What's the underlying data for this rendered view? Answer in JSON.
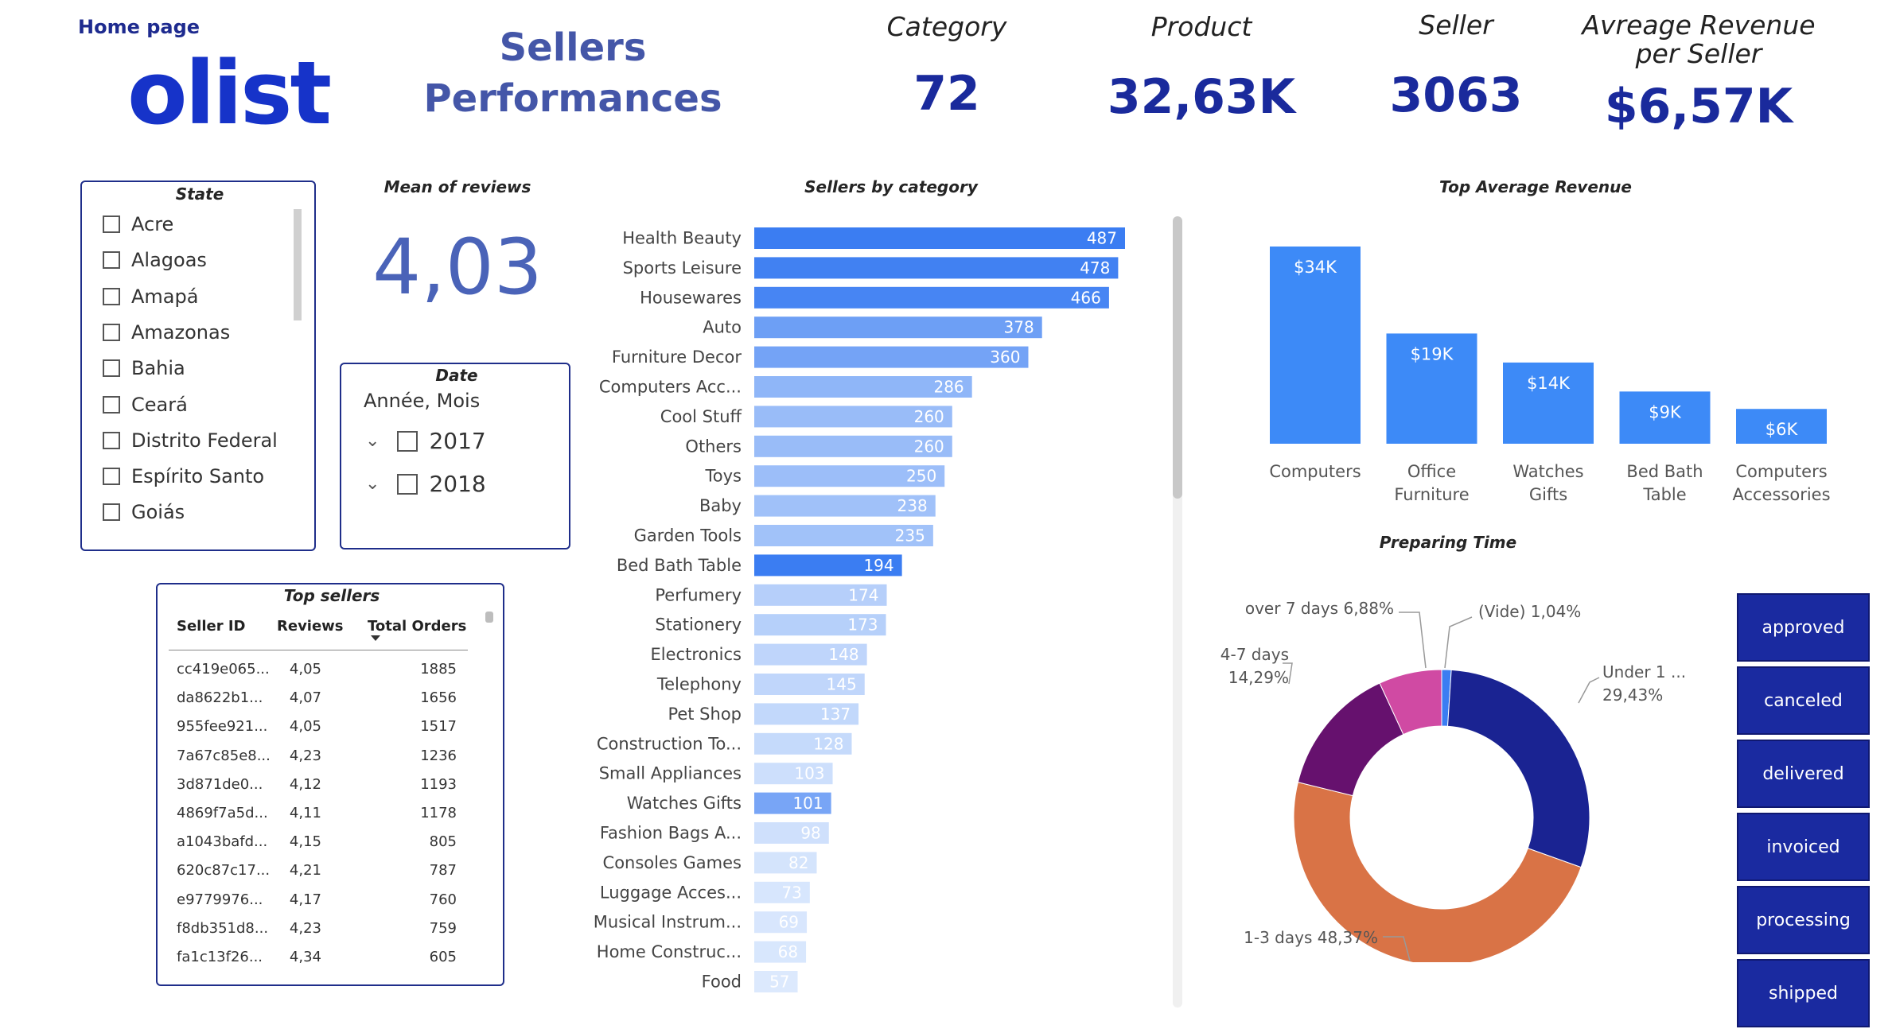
{
  "header": {
    "home_link": "Home page",
    "logo_text": "olist",
    "title_line1": "Sellers",
    "title_line2": "Performances"
  },
  "kpis": [
    {
      "label": "Category",
      "value": "72"
    },
    {
      "label": "Product",
      "value": "32,63K"
    },
    {
      "label": "Seller",
      "value": "3063"
    },
    {
      "label": "Avreage Revenue per Seller",
      "value": "$6,57K"
    }
  ],
  "state_filter": {
    "title": "State",
    "items": [
      "Acre",
      "Alagoas",
      "Amapá",
      "Amazonas",
      "Bahia",
      "Ceará",
      "Distrito Federal",
      "Espírito Santo",
      "Goiás"
    ]
  },
  "mean_reviews": {
    "title": "Mean of reviews",
    "value": "4,03"
  },
  "date_filter": {
    "title": "Date",
    "subtitle": "Année, Mois",
    "years": [
      "2017",
      "2018"
    ]
  },
  "top_sellers": {
    "title": "Top sellers",
    "columns": [
      "Seller ID",
      "Reviews",
      "Total Orders"
    ],
    "rows": [
      [
        "cc419e065...",
        "4,05",
        "1885"
      ],
      [
        "da8622b1...",
        "4,07",
        "1656"
      ],
      [
        "955fee921...",
        "4,05",
        "1517"
      ],
      [
        "7a67c85e8...",
        "4,23",
        "1236"
      ],
      [
        "3d871de0...",
        "4,12",
        "1193"
      ],
      [
        "4869f7a5d...",
        "4,11",
        "1178"
      ],
      [
        "a1043bafd...",
        "4,15",
        "805"
      ],
      [
        "620c87c17...",
        "4,21",
        "787"
      ],
      [
        "e9779976...",
        "4,17",
        "760"
      ],
      [
        "f8db351d8...",
        "4,23",
        "759"
      ],
      [
        "fa1c13f26...",
        "4,34",
        "605"
      ]
    ]
  },
  "status_buttons": [
    "approved",
    "canceled",
    "delivered",
    "invoiced",
    "processing",
    "shipped"
  ],
  "colors": {
    "accent": "#1a2aa0",
    "bar_dark": "#3b7df2",
    "bar_light": "#dce9fd"
  },
  "chart_data": [
    {
      "type": "bar",
      "orientation": "horizontal",
      "title": "Sellers by category",
      "categories": [
        "Health Beauty",
        "Sports Leisure",
        "Housewares",
        "Auto",
        "Furniture Decor",
        "Computers Acc...",
        "Cool Stuff",
        "Others",
        "Toys",
        "Baby",
        "Garden Tools",
        "Bed Bath Table",
        "Perfumery",
        "Stationery",
        "Electronics",
        "Telephony",
        "Pet Shop",
        "Construction To...",
        "Small Appliances",
        "Watches Gifts",
        "Fashion Bags A...",
        "Consoles Games",
        "Luggage Acces...",
        "Musical Instrum...",
        "Home Construc...",
        "Food"
      ],
      "values": [
        487,
        478,
        466,
        378,
        360,
        286,
        260,
        260,
        250,
        238,
        235,
        194,
        174,
        173,
        148,
        145,
        137,
        128,
        103,
        101,
        98,
        82,
        73,
        69,
        68,
        57
      ],
      "xlim": [
        0,
        487
      ]
    },
    {
      "type": "bar",
      "title": "Top Average Revenue",
      "categories": [
        "Computers",
        "Office Furniture",
        "Watches Gifts",
        "Bed Bath Table",
        "Computers Accessories"
      ],
      "values": [
        34,
        19,
        14,
        9,
        6
      ],
      "labels": [
        "$34K",
        "$19K",
        "$14K",
        "$9K",
        "$6K"
      ],
      "color": "#3d8af7"
    },
    {
      "type": "pie",
      "title": "Preparing Time",
      "slices": [
        {
          "label": "(Vide)",
          "value": 1.04,
          "text": "(Vide) 1,04%",
          "color": "#3b7df2"
        },
        {
          "label": "Under 1 ...",
          "value": 29.43,
          "text": "Under 1 ...",
          "text2": "29,43%",
          "color": "#1a2392"
        },
        {
          "label": "1-3 days",
          "value": 48.37,
          "text": "1-3 days 48,37%",
          "color": "#d97346"
        },
        {
          "label": "4-7 days",
          "value": 14.29,
          "text": "4-7 days",
          "text2": "14,29%",
          "color": "#66116e"
        },
        {
          "label": "over 7 days",
          "value": 6.88,
          "text": "over 7 days 6,88%",
          "color": "#d04aa3"
        }
      ]
    }
  ]
}
